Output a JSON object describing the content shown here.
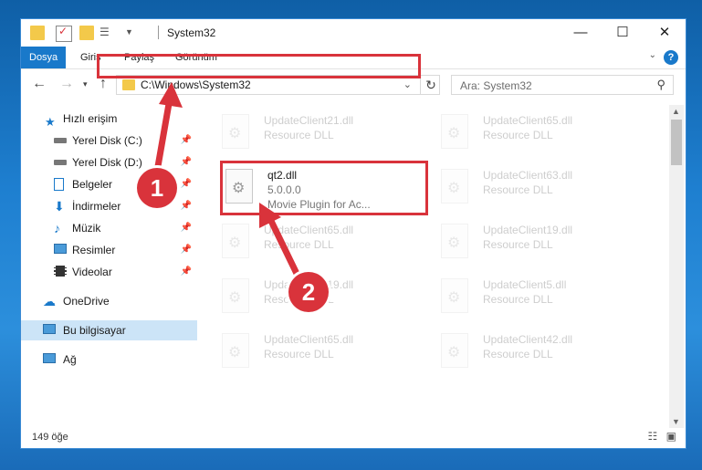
{
  "window": {
    "title": "System32",
    "controls": {
      "minimize": "—",
      "maximize": "☐",
      "close": "✕"
    }
  },
  "ribbon": {
    "tabs": [
      "Dosya",
      "Giriş",
      "Paylaş",
      "Görünüm"
    ],
    "active_tab": "Dosya"
  },
  "nav": {
    "address": "C:\\Windows\\System32",
    "search_placeholder": "Ara: System32"
  },
  "sidebar": {
    "items": [
      {
        "label": "Hızlı erişim",
        "icon": "star-icon"
      },
      {
        "label": "Yerel Disk (C:)",
        "icon": "drive-icon",
        "pinned": true
      },
      {
        "label": "Yerel Disk (D:)",
        "icon": "drive-icon",
        "pinned": true
      },
      {
        "label": "Belgeler",
        "icon": "documents-icon",
        "pinned": true
      },
      {
        "label": "İndirmeler",
        "icon": "download-icon",
        "pinned": true
      },
      {
        "label": "Müzik",
        "icon": "music-icon",
        "pinned": true
      },
      {
        "label": "Resimler",
        "icon": "pictures-icon",
        "pinned": true
      },
      {
        "label": "Videolar",
        "icon": "video-icon",
        "pinned": true
      },
      {
        "label": "OneDrive",
        "icon": "cloud-icon"
      },
      {
        "label": "Bu bilgisayar",
        "icon": "computer-icon",
        "selected": true
      },
      {
        "label": "Ağ",
        "icon": "network-icon"
      }
    ]
  },
  "files": {
    "left": [
      {
        "name": "UpdateClient21.dll",
        "desc": "Resource DLL",
        "faded": true
      },
      {
        "name": "qt2.dll",
        "version": "5.0.0.0",
        "desc": "Movie Plugin for Ac...",
        "faded": false
      },
      {
        "name": "UpdateClient65.dll",
        "desc": "Resource DLL",
        "faded": true
      },
      {
        "name": "UpdateClient19.dll",
        "desc": "Resource DLL",
        "faded": true
      },
      {
        "name": "UpdateClient65.dll",
        "desc": "Resource DLL",
        "faded": true
      }
    ],
    "right": [
      {
        "name": "UpdateClient65.dll",
        "desc": "Resource DLL"
      },
      {
        "name": "UpdateClient63.dll",
        "desc": "Resource DLL"
      },
      {
        "name": "UpdateClient19.dll",
        "desc": "Resource DLL"
      },
      {
        "name": "UpdateClient5.dll",
        "desc": "Resource DLL"
      },
      {
        "name": "UpdateClient42.dll",
        "desc": "Resource DLL"
      }
    ]
  },
  "status": {
    "item_count": "149 öğe"
  },
  "annotations": {
    "badge1": "1",
    "badge2": "2",
    "color": "#d9333b"
  }
}
